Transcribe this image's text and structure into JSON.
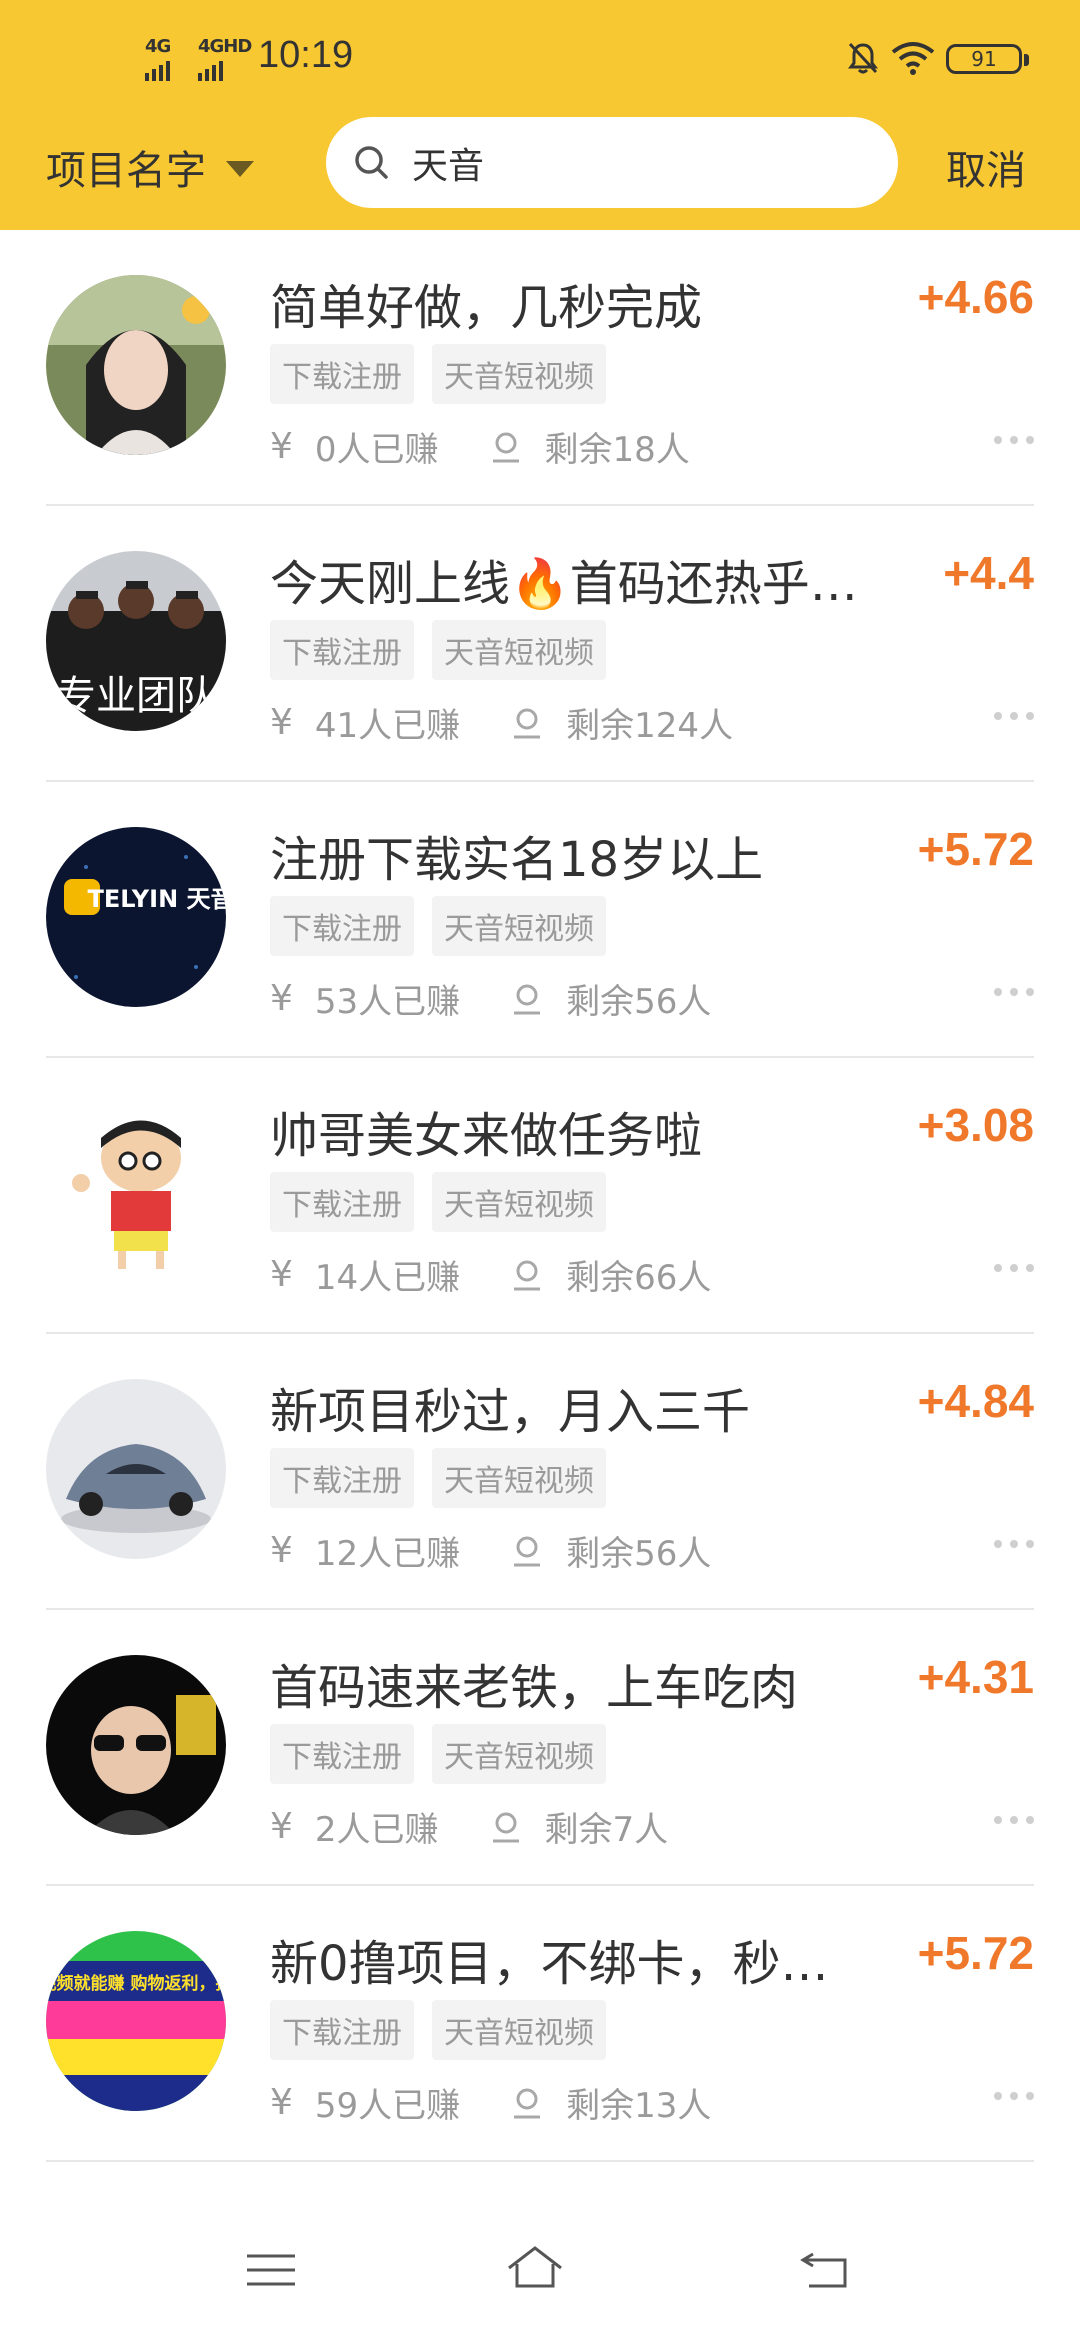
{
  "status_bar": {
    "signal_1": "4G",
    "signal_2": "4GHD",
    "time": "10:19",
    "battery": "91"
  },
  "header": {
    "selector_label": "项目名字",
    "search_value": "天音",
    "cancel_label": "取消"
  },
  "items": [
    {
      "title": "简单好做，几秒完成",
      "price": "+4.66",
      "tags": [
        "下载注册",
        "天音短视频"
      ],
      "earned": "0人已赚",
      "remaining": "剩余18人"
    },
    {
      "title": "今天刚上线🔥首码还热乎…",
      "price": "+4.4",
      "tags": [
        "下载注册",
        "天音短视频"
      ],
      "earned": "41人已赚",
      "remaining": "剩余124人",
      "avatar_text": "专业团队"
    },
    {
      "title": "注册下载实名18岁以上",
      "price": "+5.72",
      "tags": [
        "下载注册",
        "天音短视频"
      ],
      "earned": "53人已赚",
      "remaining": "剩余56人",
      "avatar_text": "TELYIN 天音"
    },
    {
      "title": "帅哥美女来做任务啦",
      "price": "+3.08",
      "tags": [
        "下载注册",
        "天音短视频"
      ],
      "earned": "14人已赚",
      "remaining": "剩余66人"
    },
    {
      "title": "新项目秒过，月入三千",
      "price": "+4.84",
      "tags": [
        "下载注册",
        "天音短视频"
      ],
      "earned": "12人已赚",
      "remaining": "剩余56人"
    },
    {
      "title": "首码速来老铁，上车吃肉",
      "price": "+4.31",
      "tags": [
        "下载注册",
        "天音短视频"
      ],
      "earned": "2人已赚",
      "remaining": "剩余7人"
    },
    {
      "title": "新0撸项目，不绑卡，秒…",
      "price": "+5.72",
      "tags": [
        "下载注册",
        "天音短视频"
      ],
      "earned": "59人已赚",
      "remaining": "剩余13人",
      "avatar_text": "两分钟视频就能赚 购物返利，推广分红"
    }
  ],
  "icons": {
    "search": "search-icon",
    "bell_off": "bell-off-icon",
    "wifi": "wifi-icon",
    "yen": "yen-icon",
    "person": "person-icon",
    "more": "more-dots-icon",
    "menu": "menu-icon",
    "home": "home-icon",
    "back": "back-icon"
  },
  "colors": {
    "header_bg": "#F8C832",
    "price": "#F0782A",
    "tag_bg": "#F3F3F3",
    "muted_text": "#9A9A9A"
  }
}
